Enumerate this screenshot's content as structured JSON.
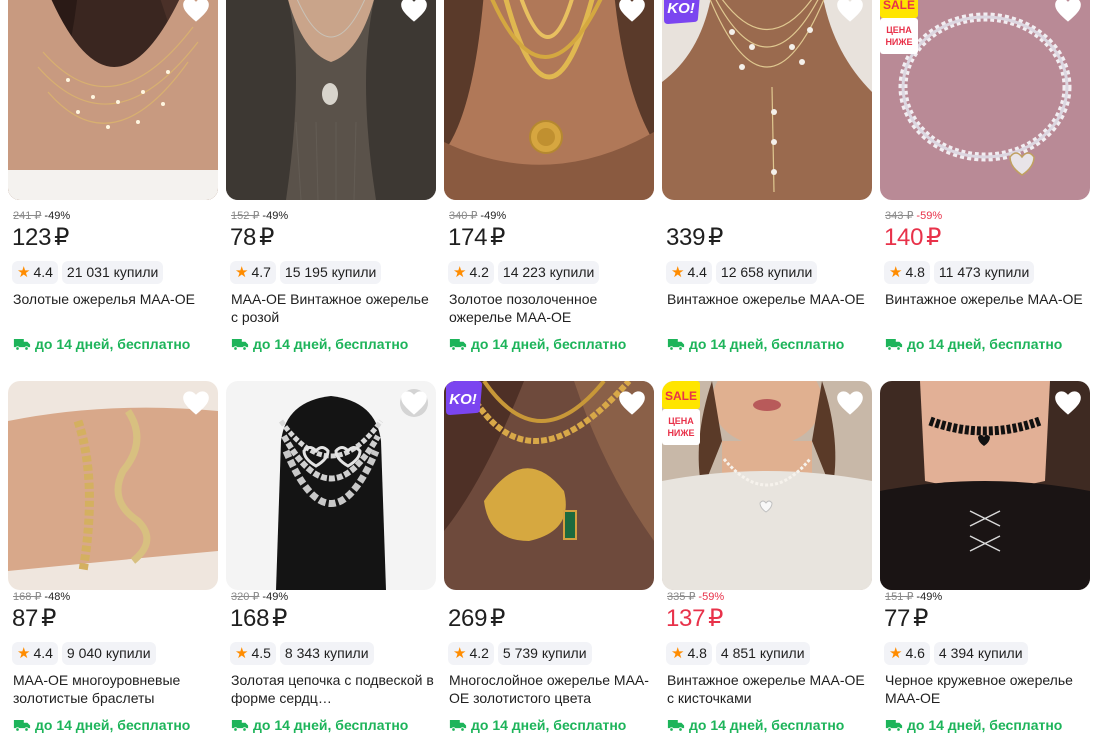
{
  "currency": "₽",
  "delivery_text": "до 14 дней, бесплатно",
  "bought_suffix": "купили",
  "badges": {
    "ko": "KO!",
    "sale": "SALE",
    "sale_sub1": "ЦЕНА",
    "sale_sub2": "НИЖЕ"
  },
  "colors": {
    "accent_green": "#1db45a",
    "sale_red": "#e8324a",
    "star": "#ff8c00",
    "ko_purple": "#7b45f0",
    "sale_yellow": "#ffe500"
  },
  "products": [
    {
      "old_price": "241 ₽",
      "discount": "-49%",
      "price": "123",
      "price_red": false,
      "rating": "4.4",
      "bought": "21 031 купили",
      "title": "Золотые ожерелья MAA-OE",
      "badge": ""
    },
    {
      "old_price": "152 ₽",
      "discount": "-49%",
      "price": "78",
      "price_red": false,
      "rating": "4.7",
      "bought": "15 195 купили",
      "title": "MAA-OE Винтажное ожерелье с розой",
      "badge": ""
    },
    {
      "old_price": "340 ₽",
      "discount": "-49%",
      "price": "174",
      "price_red": false,
      "rating": "4.2",
      "bought": "14 223 купили",
      "title": "Золотое позолоченное ожерелье MAA-OE",
      "badge": ""
    },
    {
      "old_price": "",
      "discount": "",
      "price": "339",
      "price_red": false,
      "rating": "4.4",
      "bought": "12 658 купили",
      "title": "Винтажное ожерелье MAA-OE",
      "badge": "ko"
    },
    {
      "old_price": "343 ₽",
      "discount": "-59%",
      "price": "140",
      "price_red": true,
      "rating": "4.8",
      "bought": "11 473 купили",
      "title": "Винтажное ожерелье MAA-OE",
      "badge": "sale"
    },
    {
      "old_price": "168 ₽",
      "discount": "-48%",
      "price": "87",
      "price_red": false,
      "rating": "4.4",
      "bought": "9 040 купили",
      "title": "MAA-OE многоуровневые золотистые браслеты",
      "badge": ""
    },
    {
      "old_price": "320 ₽",
      "discount": "-49%",
      "price": "168",
      "price_red": false,
      "rating": "4.5",
      "bought": "8 343 купили",
      "title": "Золотая цепочка с подвеской в форме сердц…",
      "badge": ""
    },
    {
      "old_price": "",
      "discount": "",
      "price": "269",
      "price_red": false,
      "rating": "4.2",
      "bought": "5 739 купили",
      "title": "Многослойное ожерелье MAA-OE золотистого цвета",
      "badge": "ko"
    },
    {
      "old_price": "335 ₽",
      "discount": "-59%",
      "price": "137",
      "price_red": true,
      "rating": "4.8",
      "bought": "4 851 купили",
      "title": "Винтажное ожерелье MAA-OE с кисточками",
      "badge": "sale"
    },
    {
      "old_price": "151 ₽",
      "discount": "-49%",
      "price": "77",
      "price_red": false,
      "rating": "4.6",
      "bought": "4 394 купили",
      "title": "Черное кружевное ожерелье MAA-OE",
      "badge": ""
    }
  ]
}
